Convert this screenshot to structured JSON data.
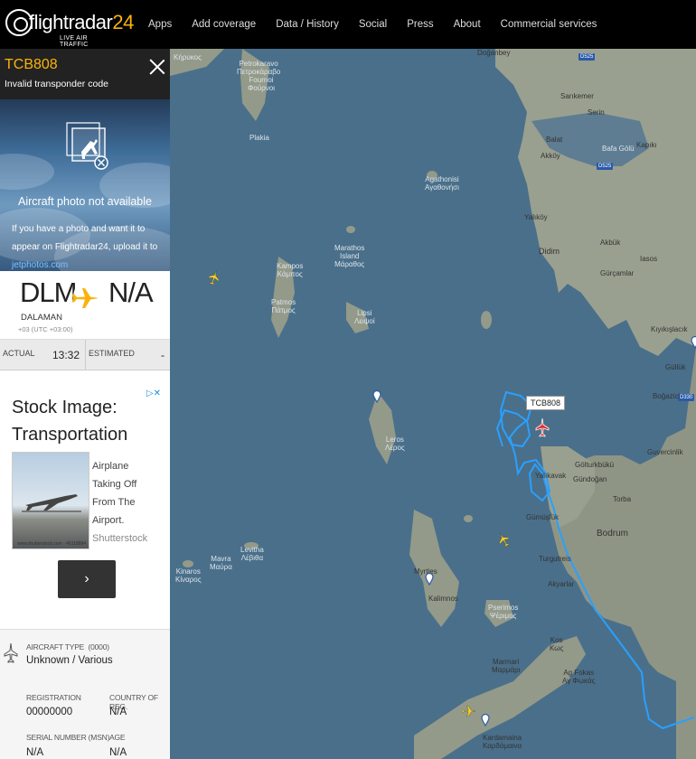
{
  "header": {
    "logo_text": "flightradar",
    "logo_number": "24",
    "logo_tagline": "LIVE AIR TRAFFIC",
    "nav": [
      "Apps",
      "Add coverage",
      "Data / History",
      "Social",
      "Press",
      "About",
      "Commercial services"
    ]
  },
  "flight": {
    "callsign": "TCB808",
    "subtitle": "Invalid transponder code"
  },
  "photo": {
    "title": "Aircraft photo not available",
    "desc_line": "If you have a photo and want it to appear on Flightradar24, upload it to",
    "link": "jetphotos.com"
  },
  "route": {
    "origin_iata": "DLM",
    "origin_city": "DALAMAN",
    "origin_tz": "+03 (UTC +03:00)",
    "dest_iata": "N/A"
  },
  "times": {
    "actual_label": "ACTUAL",
    "actual_value": "13:32",
    "estimated_label": "ESTIMATED",
    "estimated_value": "-"
  },
  "ad": {
    "title": "Stock Image: Transportation",
    "caption": "Airplane Taking Off From The Airport.",
    "brand": "Shutterstock",
    "image_caption": "www.shutterstock.com · 46118884",
    "button_glyph": "›"
  },
  "aircraft": {
    "type_label": "AIRCRAFT TYPE",
    "type_code": "(0000)",
    "type_value": "Unknown / Various",
    "registration_label": "REGISTRATION",
    "registration_value": "00000000",
    "country_label": "COUNTRY OF REG.",
    "country_value": "N/A",
    "serial_label": "SERIAL NUMBER (MSN)",
    "serial_value": "N/A",
    "age_label": "AGE",
    "age_value": "N/A"
  },
  "map": {
    "selected_callsign": "TCB808",
    "places": {
      "dogan": "Doğanbey",
      "kirokos": "Κήρυκος",
      "petrokaravo": "Petrokaravo\nΠετροκάραβο",
      "fournoi": "Fournoi\nΦούρνοι",
      "plakia": "Plakia",
      "sarikemer": "Sarıkemer",
      "serinin": "Serin",
      "balat": "Balat",
      "akkoy": "Akköy",
      "bafa": "Bafa Gölü",
      "kapikiri": "Kapıkı",
      "agathonisi": "Agathonisi\nΑγαθονήσι",
      "yalikoy": "Yalıköy",
      "didim": "Didim",
      "marathos": "Marathos\nIsland\nΜάραθος",
      "kamposs": "Kampos\nΚάμπος",
      "patmos": "Patmos\nΠάτμος",
      "lipsi": "Lipsi\nΛειψοί",
      "akbuk": "Akbük",
      "iasos": "Iasos",
      "gurcamlar": "Gürçamlar",
      "kiyikislacik": "Kıyıkışlacık",
      "gulluk": "Güllük",
      "bogazici": "Boğazici",
      "leros": "Leros\nΛέρος",
      "yalikavak": "Yalıkavak",
      "golturkbuku": "Gölturkbükü",
      "gundogan": "Gündoğan",
      "torba": "Torba",
      "guvercinlik": "Guvercinlik",
      "gumusluk": "Gümüşlük",
      "bodrum": "Bodrum",
      "turgutreis": "Turgutreis",
      "akyarlar": "Akyarlar",
      "mavra": "Mavra\nΜαύρα",
      "levitha": "Levitha\nΛέβιθα",
      "kinaros": "Kinaros\nΚίναρος",
      "myrties": "Myrties",
      "kalimnos": "Kalimnos",
      "pserimos": "Pserimos\nΨέριμος",
      "kos": "Kos\nΚως",
      "marmari": "Marmari\nΜαρμάρι",
      "agfokas": "Ag Fokas\nΑγ Φωκάς",
      "kardamaina": "Kardamaina\nΚαρδάμαινα",
      "d525": "D525",
      "d525b": "D525",
      "d330": "D330"
    }
  }
}
